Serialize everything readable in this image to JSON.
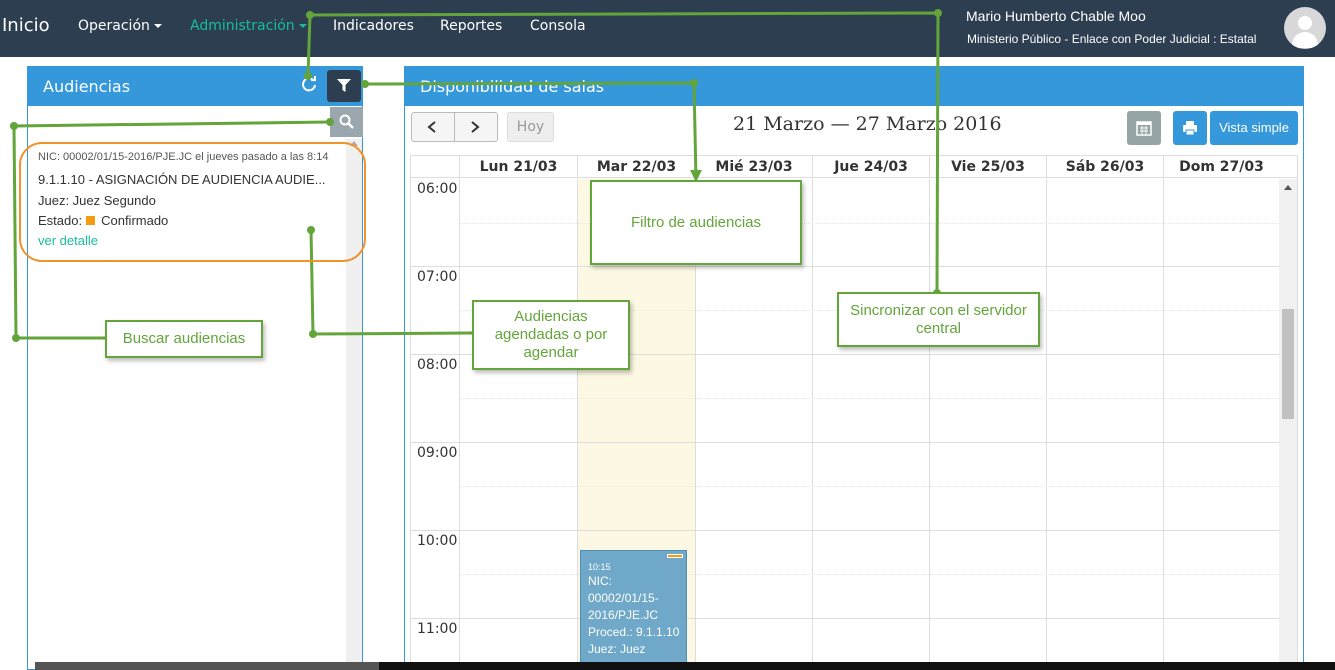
{
  "nav": {
    "brand": "Inicio",
    "items": [
      {
        "label": "Operación",
        "dropdown": true,
        "active": false
      },
      {
        "label": "Administración",
        "dropdown": true,
        "active": true
      },
      {
        "label": "Indicadores",
        "dropdown": false,
        "active": false
      },
      {
        "label": "Reportes",
        "dropdown": false,
        "active": false
      },
      {
        "label": "Consola",
        "dropdown": false,
        "active": false
      }
    ],
    "user_name": "Mario Humberto Chable Moo",
    "user_org": "Ministerio Público - Enlace con Poder Judicial : Estatal",
    "avatar_icon": "user-avatar-icon"
  },
  "left_panel": {
    "title": "Audiencias",
    "refresh_icon": "refresh-icon",
    "filter_icon": "filter-icon",
    "search_placeholder": "",
    "search_icon": "search-icon",
    "card": {
      "nic": "NIC: 00002/01/15-2016/PJE.JC el jueves pasado a las 8:14",
      "title": "9.1.1.10 - ASIGNACIÓN DE AUDIENCIA AUDIE...",
      "judge": "Juez: Juez Segundo",
      "status_label": "Estado:",
      "status_value": "Confirmado",
      "status_color": "#f39c12",
      "link": "ver detalle"
    }
  },
  "right_panel": {
    "title": "Disponibilidad de salas",
    "today_button": "Hoy",
    "date_range": "21 Marzo — 27 Marzo 2016",
    "simple_view_button": "Vista simple",
    "calendar_icon": "calendar-icon",
    "print_icon": "print-icon",
    "days": [
      "Lun 21/03",
      "Mar 22/03",
      "Mié 23/03",
      "Jue 24/03",
      "Vie 25/03",
      "Sáb 26/03",
      "Dom 27/03"
    ],
    "hours": [
      "06:00",
      "07:00",
      "08:00",
      "09:00",
      "10:00",
      "11:00"
    ],
    "event": {
      "time": "10:15",
      "lines": [
        "NIC:",
        "00002/01/15-",
        "2016/PJE.JC",
        "Proced.: 9.1.1.10",
        "Juez: Juez"
      ]
    }
  },
  "annotations": {
    "filter": "Filtro de audiencias",
    "sync": "Sincronizar con el servidor central",
    "scheduled": "Audiencias agendadas o por agendar",
    "search": "Buscar audiencias"
  },
  "colors": {
    "navbar": "#2c3e50",
    "accent": "#18bc9c",
    "panel_header": "#3498db",
    "annotation": "#63a53a"
  }
}
